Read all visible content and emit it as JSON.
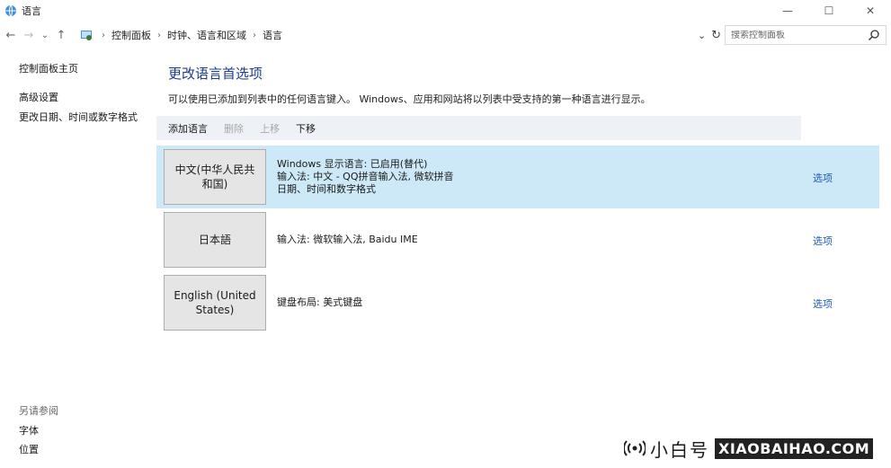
{
  "window": {
    "title": "语言",
    "minimize": "—",
    "maximize": "☐",
    "close": "✕"
  },
  "nav": {
    "back": "←",
    "forward": "→",
    "recent": "⌄",
    "up": "↑",
    "breadcrumbs": [
      "控制面板",
      "时钟、语言和区域",
      "语言"
    ],
    "dropdown": "⌄",
    "refresh": "↻",
    "search_placeholder": "搜索控制面板"
  },
  "sidebar": {
    "items": [
      "控制面板主页",
      "高级设置",
      "更改日期、时间或数字格式"
    ],
    "see_also_label": "另请参阅",
    "see_also": [
      "字体",
      "位置"
    ]
  },
  "main": {
    "title": "更改语言首选项",
    "description": "可以使用已添加到列表中的任何语言键入。 Windows、应用和网站将以列表中受支持的第一种语言进行显示。",
    "toolbar": {
      "add": "添加语言",
      "remove": "删除",
      "up": "上移",
      "down": "下移"
    },
    "languages": [
      {
        "name": "中文(中华人民共和国)",
        "lines": [
          "Windows 显示语言: 已启用(替代)",
          "输入法: 中文 - QQ拼音输入法, 微软拼音",
          "日期、时间和数字格式"
        ],
        "options": "选项",
        "selected": true
      },
      {
        "name": "日本語",
        "lines": [
          "输入法: 微软输入法, Baidu IME"
        ],
        "options": "选项",
        "selected": false
      },
      {
        "name": "English (United States)",
        "lines": [
          "键盘布局: 美式键盘"
        ],
        "options": "选项",
        "selected": false
      }
    ]
  },
  "watermark": {
    "text": "小白号",
    "domain": "XIAOBAIHAO.COM"
  },
  "colors": {
    "title_blue": "#1e3c8c",
    "link_blue": "#1e5bb4",
    "selected_row": "#cde8f7",
    "toolbar_bg": "#eef2f6"
  }
}
